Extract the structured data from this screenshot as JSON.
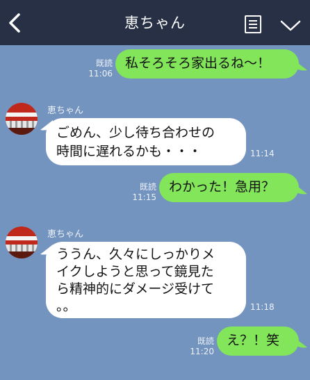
{
  "header": {
    "title": "恵ちゃん",
    "back_icon": "chevron-left-icon",
    "menu_icon": "notes-icon",
    "expand_icon": "chevron-down-icon"
  },
  "colors": {
    "header_bg": "#283046",
    "chat_bg": "#7494c0",
    "outgoing_bubble": "#82e55a",
    "incoming_bubble": "#ffffff"
  },
  "messages": [
    {
      "direction": "out",
      "read_label": "既読",
      "time": "11:06",
      "text": "私そろそろ家出るね〜！"
    },
    {
      "direction": "in",
      "sender": "恵ちゃん",
      "time": "11:14",
      "lines": [
        "ごめん、少し待ち合わせの",
        "時間に遅れるかも・・・"
      ]
    },
    {
      "direction": "out",
      "read_label": "既読",
      "time": "11:15",
      "text": "わかった！急用？"
    },
    {
      "direction": "in",
      "sender": "恵ちゃん",
      "time": "11:18",
      "lines": [
        "ううん、久々にしっかりメ",
        "イクしようと思って鏡見た",
        "ら精神的にダメージ受けて",
        "。。"
      ]
    },
    {
      "direction": "out",
      "read_label": "既読",
      "time": "11:20",
      "text": "え？！笑"
    }
  ]
}
